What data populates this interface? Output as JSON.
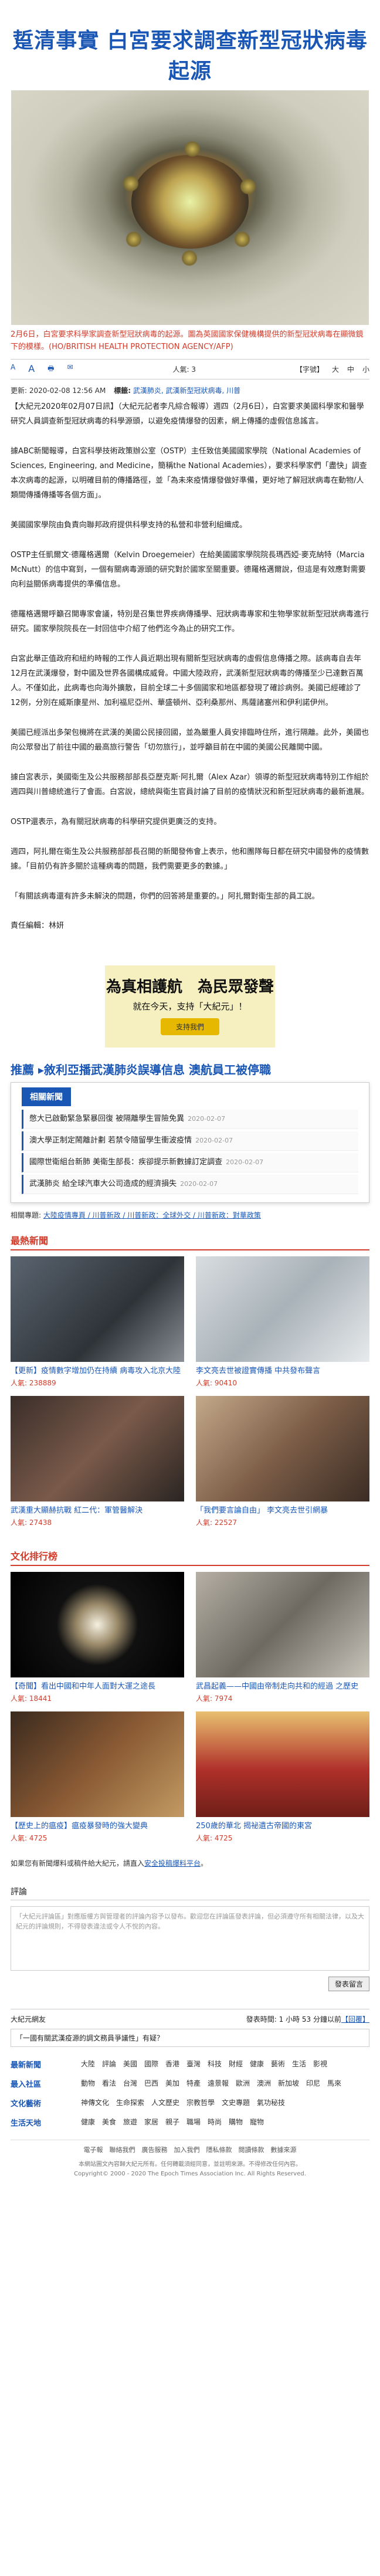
{
  "headline": "踅清事實 白宮要求調查新型冠狀病毒起源",
  "caption": "2月6日，白宮要求科學家調查新型冠狀病毒的起源。圖為英國國家保健機構提供的新型冠狀病毒在顯微鏡下的模樣。(HO/BRITISH HEALTH PROTECTION AGENCY/AFP)",
  "toolbar": {
    "font_small": "A",
    "font_large": "A",
    "print": "🖶",
    "mail": "✉",
    "views_label": "人氣: 3",
    "font_label": "【字號】",
    "size_big": "大",
    "size_mid": "中",
    "size_small": "小"
  },
  "meta": {
    "updated": "更新: 2020-02-08 12:56 AM",
    "tag_label": "標籤:",
    "tags": "武漢肺炎, 武漢新型冠狀病毒, 川普"
  },
  "body": [
    "【大紀元2020年02月07日訊】（大紀元記者李凡綜合報導）週四（2月6日），白宮要求美國科學家和醫學研究人員調查新型冠狀病毒的科學源頭，以避免疫情爆發的因素，網上傳播的虛假信息謠言。",
    "據ABC新聞報導，白宮科學技術政策辦公室（OSTP）主任致信美國國家學院（National Academies of Sciences, Engineering, and Medicine，簡稱the National Academies），要求科學家們「盡快」調查本次病毒的起源，以明確目前的傳播路徑，並「為未來疫情爆發做好準備，更好地了解冠狀病毒在動物/人類間傳播傳播等各個方面」。",
    "美國國家學院由負責向聯邦政府提供科學支持的私營和非營利組織成。",
    "OSTP主任凱爾文·德羅格邁爾（Kelvin Droegemeier）在給美國國家學院院長瑪西婭·麥克納特（Marcia McNutt）的信中寫到，一個有關病毒源頭的研究對於國家至關重要。德羅格邁爾說，但這是有效應對需要向利益關係病毒提供的準備信息。",
    "德羅格邁爾呼籲召開專家會議，特別是召集世界疾病傳播學、冠狀病毒專家和生物學家就新型冠狀病毒進行研究。國家學院院長在一封回信中介紹了他們迄今為止的研究工作。",
    "白宮此舉正值政府和紐約時報的工作人員近期出現有關新型冠狀病毒的虛假信息傳播之際。該病毒自去年12月在武漢爆發，對中國及世界各國構成威脅。中國大陸政府，武漢新型冠狀病毒的傳播至少已達數百萬人。不僅如此，此病毒也向海外擴散，目前全球二十多個國家和地區都發現了確診病例。美國已經確診了12例，分別在威斯康星州、加利福尼亞州、華盛頓州、亞利桑那州、馬薩諸塞州和伊利諾伊州。",
    "美國已經派出多架包機將在武漢的美國公民接回國，並為嚴重人員安排臨時住所，進行隔離。此外，美國也向公眾發出了前往中國的最高旅行警告「切勿旅行」，並呼籲目前在中國的美國公民離開中國。",
    "據白宮表示，美國衛生及公共服務部部長亞歷克斯·阿扎爾（Alex Azar）領導的新型冠狀病毒特別工作組於週四與川普總統進行了會面。白宮說，總統與衛生官員討論了目前的疫情狀況和新型冠狀病毒的最新進展。",
    "OSTP還表示，為有關冠狀病毒的科學研究提供更廣泛的支持。",
    "週四，阿扎爾在衛生及公共服務部部長召開的新聞發佈會上表示，他和團隊每日都在研究中國發佈的疫情數據。「目前仍有許多關於這種病毒的問題，我們需要更多的數據。」",
    "「有關該病毒還有許多未解決的問題，你們的回答將是重要的。」阿扎爾對衛生部的員工說。"
  ],
  "editor": "責任編輯：林妍",
  "promo": {
    "line1": "為真相護航　為民眾發聲",
    "line2": "就在今天，支持「大紀元」！",
    "button": "支持我們"
  },
  "related": {
    "title": "推薦 ▸敘利亞播武漢肺炎誤導信息 澳航員工被停職",
    "header": "相關新聞",
    "items": [
      {
        "text": "憋大已啟動緊急緊暴回復 被隔離學生冒險免異",
        "date": "2020-02-07"
      },
      {
        "text": "澳大學正制定鬧離計劃 若禁令隨留學生衝波疫情",
        "date": "2020-02-07"
      },
      {
        "text": "國際世衛組台新肺 美衛生部長：疾卻提示新數據訂定調查",
        "date": "2020-02-07"
      },
      {
        "text": "武漢肺炎 給全球汽車大公司造成的經濟損失",
        "date": "2020-02-07"
      }
    ]
  },
  "related_tags": {
    "label": "相關專題:",
    "items": "大陸疫情專頁 / 川普新政 / 川普新政：全球外交 / 川普新政：對華政策"
  },
  "latest": {
    "title": "最熱新聞",
    "items": [
      {
        "title": "【更新】疫情數字增加仍在持續 病毒攻入北京大陸",
        "views": "人氣: 238889"
      },
      {
        "title": "李文亮去世被證實傳播 中共發布聲言",
        "views": "人氣: 90410"
      },
      {
        "title": "武漢重大顯赫抗戰 紅二代：軍管醫解決",
        "views": "人氣: 27438"
      },
      {
        "title": "「我們要言論自由」 李文亮去世引網暴",
        "views": "人氣: 22527"
      }
    ]
  },
  "culture": {
    "title": "文化排行榜",
    "items": [
      {
        "title": "【奇聞】看出中國和中年人面對大運之途長",
        "views": "人氣: 18441"
      },
      {
        "title": "武昌起義——中國由帝制走向共和的經過 之歷史",
        "views": "人氣: 7974"
      },
      {
        "title": "【歷史上的瘟疫】瘟疫暴發時的強大變典",
        "views": "人氣: 4725"
      },
      {
        "title": "250歲的華北 揭祕遺古帝國的東宮",
        "views": "人氣: 4725"
      }
    ]
  },
  "note": {
    "text": "如果您有新聞爆料或稿件給大紀元，請直入",
    "link": "安全投稿爆料平台",
    "end": "。"
  },
  "comments": {
    "title": "評論",
    "placeholder": "「大紀元評論區」對應版權方與管理者的評論內容予以發布。歡迎您在評論區發表評論，但必須遵守所有相關法律，以及大紀元的評論規則，不得發表違法或令人不悅的內容。",
    "submit": "發表留言"
  },
  "bottom_bar": {
    "left": "大紀元網友",
    "right_prefix": "發表時間: 1 小時 53 分鐘以前",
    "right_link": "【回覆】"
  },
  "poll": "「一國有關武漢疫源的調文務員爭議性」有疑？",
  "footer_nav": [
    {
      "k": "最新新聞",
      "items": [
        "大陸",
        "評論",
        "美國",
        "國際",
        "香港",
        "臺灣",
        "科技",
        "財經",
        "健康",
        "藝術",
        "生活",
        "影視"
      ]
    },
    {
      "k": "最入社區",
      "items": [
        "動物",
        "看法",
        "台灣",
        "巴西",
        "美加",
        "特產",
        "遠景報",
        "歐洲",
        "澳洲",
        "新加坡",
        "印尼",
        "馬來"
      ]
    },
    {
      "k": "文化藝術",
      "items": [
        "神傳文化",
        "生命探索",
        "人文歷史",
        "宗教哲學",
        "文史專題",
        "氣功秘技"
      ]
    },
    {
      "k": "生活天地",
      "items": [
        "健康",
        "美食",
        "旅遊",
        "家居",
        "親子",
        "職場",
        "時尚",
        "購物",
        "寵物"
      ]
    }
  ],
  "footer_links": "電子報　聯絡我們　廣告服務　加入我們　隱私條款　閱讀條款　數據來源",
  "copyright": "本網站圖文內容歸大紀元所有。任何轉載須經同意，並註明來源。不得修改任何內容。\nCopyright© 2000 - 2020 The Epoch Times Association Inc. All Rights Reserved."
}
